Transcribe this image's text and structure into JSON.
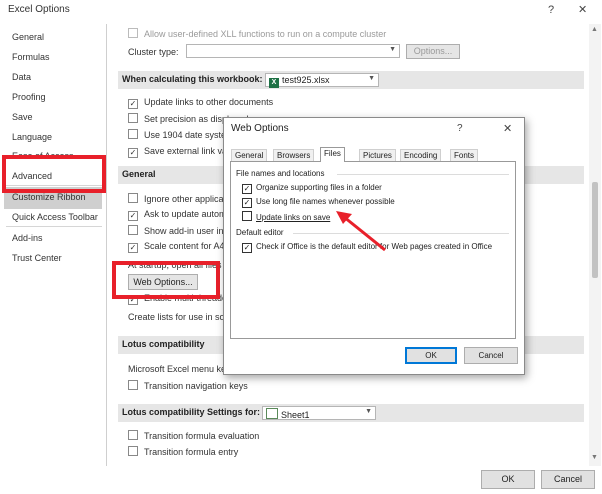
{
  "window": {
    "title": "Excel Options",
    "help_glyph": "?",
    "close_glyph": "✕"
  },
  "sidebar": {
    "items": [
      "General",
      "Formulas",
      "Data",
      "Proofing",
      "Save",
      "Language",
      "Ease of Access",
      "Advanced",
      "Customize Ribbon",
      "Quick Access Toolbar",
      "Add-ins",
      "Trust Center"
    ],
    "selected": "Advanced"
  },
  "content": {
    "xll_label": "Allow user-defined XLL functions to run on a compute cluster",
    "cluster_type_label": "Cluster type:",
    "options_button": "Options...",
    "calc_section": "When calculating this workbook:",
    "calc_workbook": "test925.xlsx",
    "calc_items": [
      "Update links to other documents",
      "Set precision as displayed",
      "Use 1904 date system",
      "Save external link values"
    ],
    "general_section": "General",
    "general_items": [
      "Ignore other applications that use Dynamic Data Exchange (DDE)",
      "Ask to update automatic links",
      "Show add-in user interface errors",
      "Scale content for A4 or 8.5 x 11\" paper sizes"
    ],
    "startup_label": "At startup, open all files in:",
    "web_options_button": "Web Options...",
    "multithreaded_label": "Enable multi-threaded processing",
    "lists_label": "Create lists for use in sorts and fill sequences:",
    "lotus_section": "Lotus compatibility",
    "menu_key_label": "Microsoft Excel menu key:",
    "menu_key_value": "/",
    "transition_nav": "Transition navigation keys",
    "lotus_settings_section": "Lotus compatibility Settings for:",
    "lotus_sheet": "Sheet1",
    "transition_formula_eval": "Transition formula evaluation",
    "transition_formula_entry": "Transition formula entry"
  },
  "footer": {
    "ok": "OK",
    "cancel": "Cancel"
  },
  "dialog": {
    "title": "Web Options",
    "help_glyph": "?",
    "close_glyph": "✕",
    "tabs": [
      "General",
      "Browsers",
      "Files",
      "Pictures",
      "Encoding",
      "Fonts"
    ],
    "active_tab": "Files",
    "group1": "File names and locations",
    "opt_organize": "Organize supporting files in a folder",
    "opt_long_names": "Use long file names whenever possible",
    "opt_update_links": "Update links on save",
    "group2": "Default editor",
    "opt_default_editor": "Check if Office is the default editor for Web pages created in Office",
    "ok": "OK",
    "cancel": "Cancel"
  },
  "colors": {
    "highlight": "#e8202a",
    "selected_bg": "#cfcfcf",
    "section_bg": "#e6e6e6",
    "focus": "#0078d7"
  }
}
